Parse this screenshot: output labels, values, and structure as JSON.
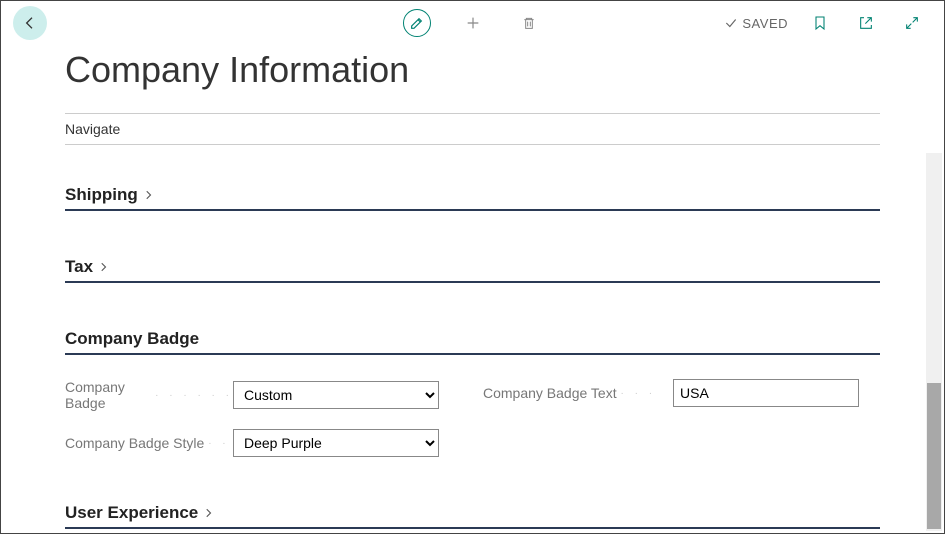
{
  "header": {
    "saved_label": "SAVED"
  },
  "page": {
    "title": "Company Information",
    "nav_label": "Navigate"
  },
  "tabs": {
    "shipping": {
      "label": "Shipping"
    },
    "tax": {
      "label": "Tax"
    },
    "company_badge": {
      "label": "Company Badge"
    },
    "user_experience": {
      "label": "User Experience"
    }
  },
  "fields": {
    "company_badge": {
      "label": "Company Badge",
      "value": "Custom"
    },
    "company_badge_style": {
      "label": "Company Badge Style",
      "value": "Deep Purple"
    },
    "company_badge_text": {
      "label": "Company Badge Text",
      "value": "USA"
    }
  }
}
